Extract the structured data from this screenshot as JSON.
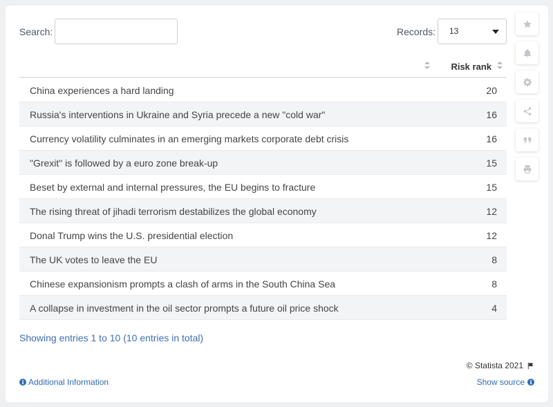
{
  "toolbar": {
    "search_label": "Search:",
    "search_value": "",
    "records_label": "Records:",
    "records_value": "13"
  },
  "side_tools": [
    "star-icon",
    "bell-icon",
    "gear-icon",
    "share-icon",
    "quote-icon",
    "print-icon"
  ],
  "table": {
    "columns": [
      "",
      "Risk rank"
    ],
    "rows": [
      {
        "name": "China experiences a hard landing",
        "rank": "20"
      },
      {
        "name": "Russia's interventions in Ukraine and Syria precede a new \"cold war\"",
        "rank": "16"
      },
      {
        "name": "Currency volatility culminates in an emerging markets corporate debt crisis",
        "rank": "16"
      },
      {
        "name": "\"Grexit\" is followed by a euro zone break-up",
        "rank": "15"
      },
      {
        "name": "Beset by external and internal pressures, the EU begins to fracture",
        "rank": "15"
      },
      {
        "name": "The rising threat of jihadi terrorism destabilizes the global economy",
        "rank": "12"
      },
      {
        "name": "Donal Trump wins the U.S. presidential election",
        "rank": "12"
      },
      {
        "name": "The UK votes to leave the EU",
        "rank": "8"
      },
      {
        "name": "Chinese expansionism prompts a clash of arms in the South China Sea",
        "rank": "8"
      },
      {
        "name": "A collapse in investment in the oil sector prompts a future oil price shock",
        "rank": "4"
      }
    ]
  },
  "footer": {
    "showing": "Showing entries 1 to 10 (10 entries in total)",
    "copyright": "© Statista 2021",
    "additional_info": "Additional Information",
    "show_source": "Show source"
  },
  "chart_data": {
    "type": "table",
    "columns": [
      "",
      "Risk rank"
    ],
    "categories": [
      "China experiences a hard landing",
      "Russia's interventions in Ukraine and Syria precede a new \"cold war\"",
      "Currency volatility culminates in an emerging markets corporate debt crisis",
      "\"Grexit\" is followed by a euro zone break-up",
      "Beset by external and internal pressures, the EU begins to fracture",
      "The rising threat of jihadi terrorism destabilizes the global economy",
      "Donal Trump wins the U.S. presidential election",
      "The UK votes to leave the EU",
      "Chinese expansionism prompts a clash of arms in the South China Sea",
      "A collapse in investment in the oil sector prompts a future oil price shock"
    ],
    "values": [
      20,
      16,
      16,
      15,
      15,
      12,
      12,
      8,
      8,
      4
    ]
  }
}
